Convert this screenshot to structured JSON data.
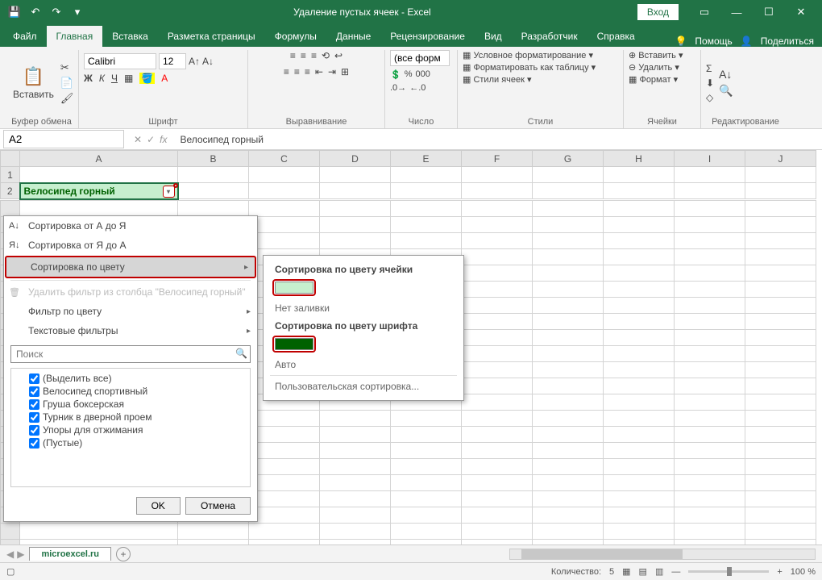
{
  "title": "Удаление пустых ячеек  -  Excel",
  "signin": "Вход",
  "tabs": [
    "Файл",
    "Главная",
    "Вставка",
    "Разметка страницы",
    "Формулы",
    "Данные",
    "Рецензирование",
    "Вид",
    "Разработчик",
    "Справка"
  ],
  "active_tab": 1,
  "tell_me": "Помощь",
  "share": "Поделиться",
  "ribbon": {
    "clipboard": {
      "paste": "Вставить",
      "label": "Буфер обмена"
    },
    "font": {
      "name": "Calibri",
      "size": "12",
      "label": "Шрифт"
    },
    "alignment": {
      "label": "Выравнивание"
    },
    "number": {
      "format": "(все форм",
      "label": "Число"
    },
    "styles": {
      "cond": "Условное форматирование",
      "table": "Форматировать как таблицу",
      "cell": "Стили ячеек",
      "label": "Стили"
    },
    "cells": {
      "insert": "Вставить",
      "delete": "Удалить",
      "format": "Формат",
      "label": "Ячейки"
    },
    "editing": {
      "label": "Редактирование"
    }
  },
  "namebox": "A2",
  "formula": "Велосипед горный",
  "columns": [
    "A",
    "B",
    "C",
    "D",
    "E",
    "F",
    "G",
    "H",
    "I",
    "J"
  ],
  "row1": "1",
  "row2": "2",
  "a2_value": "Велосипед горный",
  "filter_menu": {
    "sort_asc": "Сортировка от А до Я",
    "sort_desc": "Сортировка от Я до А",
    "sort_color": "Сортировка по цвету",
    "clear": "Удалить фильтр из столбца \"Велосипед горный\"",
    "filter_color": "Фильтр по цвету",
    "text_filters": "Текстовые фильтры",
    "search_ph": "Поиск",
    "items": [
      "(Выделить все)",
      "Велосипед спортивный",
      "Груша боксерская",
      "Турник в дверной проем",
      "Упоры для отжимания",
      "(Пустые)"
    ],
    "ok": "OK",
    "cancel": "Отмена"
  },
  "submenu": {
    "by_cell": "Сортировка по цвету ячейки",
    "no_fill": "Нет заливки",
    "by_font": "Сортировка по цвету шрифта",
    "auto": "Авто",
    "custom": "Пользовательская сортировка...",
    "swatch1": "#c6efce",
    "swatch2": "#006100"
  },
  "sheet": "microexcel.ru",
  "status": {
    "count_lbl": "Количество:",
    "count": "5",
    "zoom": "100 %"
  }
}
